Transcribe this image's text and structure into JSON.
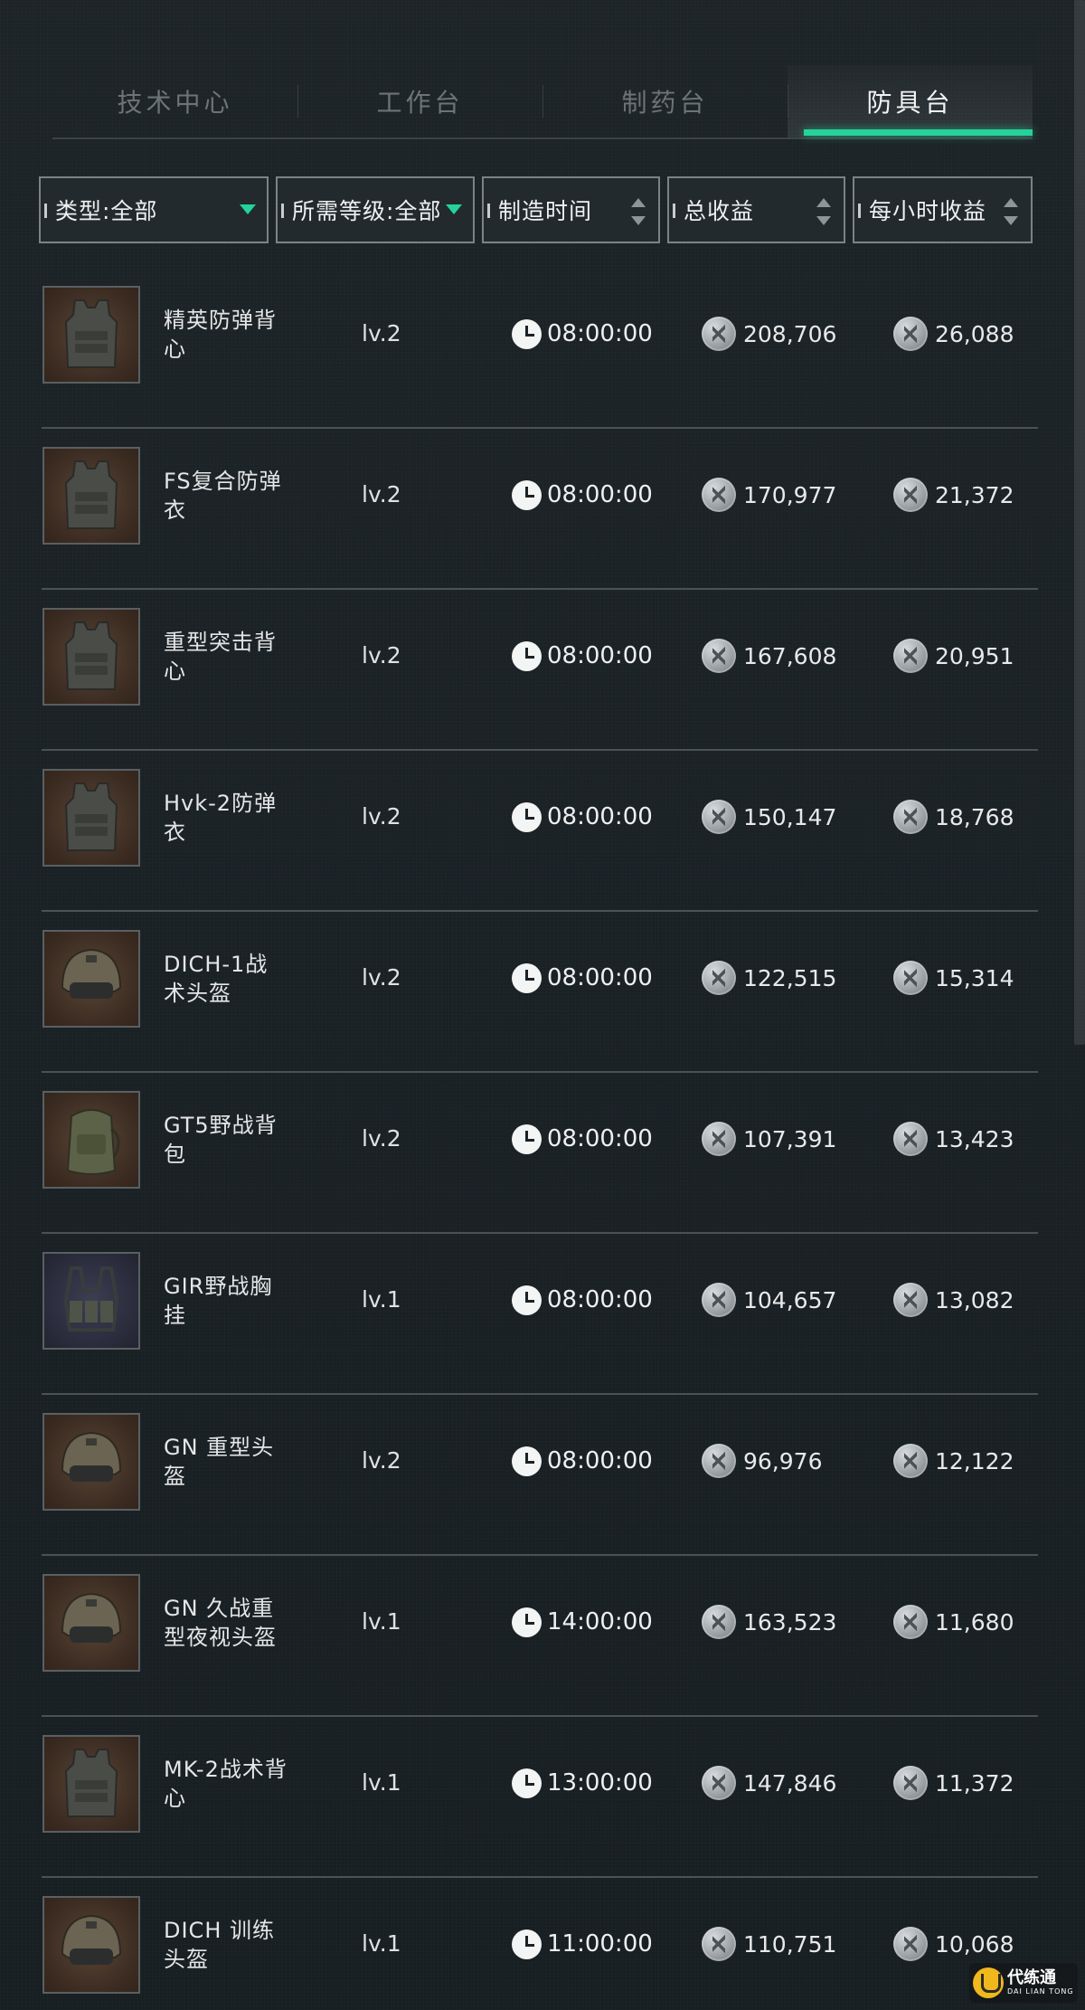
{
  "tabs": [
    {
      "label": "技术中心",
      "active": false
    },
    {
      "label": "工作台",
      "active": false
    },
    {
      "label": "制药台",
      "active": false
    },
    {
      "label": "防具台",
      "active": true
    }
  ],
  "filters": {
    "type": "类型:全部",
    "level": "所需等级:全部",
    "time": "制造时间",
    "total": "总收益",
    "hourly": "每小时收益"
  },
  "colors": {
    "accent": "#24d39a",
    "background": "#1b2226"
  },
  "items": [
    {
      "name": "精英防弹背心",
      "level": "lv.2",
      "time": "08:00:00",
      "total": "208,706",
      "hourly": "26,088",
      "icon": "vest-icon"
    },
    {
      "name": "FS复合防弹衣",
      "level": "lv.2",
      "time": "08:00:00",
      "total": "170,977",
      "hourly": "21,372",
      "icon": "vest-icon"
    },
    {
      "name": "重型突击背心",
      "level": "lv.2",
      "time": "08:00:00",
      "total": "167,608",
      "hourly": "20,951",
      "icon": "vest-icon"
    },
    {
      "name": "Hvk-2防弹衣",
      "level": "lv.2",
      "time": "08:00:00",
      "total": "150,147",
      "hourly": "18,768",
      "icon": "vest-icon"
    },
    {
      "name": "DICH-1战术头盔",
      "level": "lv.2",
      "time": "08:00:00",
      "total": "122,515",
      "hourly": "15,314",
      "icon": "helmet-icon"
    },
    {
      "name": "GT5野战背包",
      "level": "lv.2",
      "time": "08:00:00",
      "total": "107,391",
      "hourly": "13,423",
      "icon": "backpack-icon"
    },
    {
      "name": "GIR野战胸挂",
      "level": "lv.1",
      "time": "08:00:00",
      "total": "104,657",
      "hourly": "13,082",
      "icon": "chest-rig-icon"
    },
    {
      "name": "GN 重型头盔",
      "level": "lv.2",
      "time": "08:00:00",
      "total": "96,976",
      "hourly": "12,122",
      "icon": "helmet-icon"
    },
    {
      "name": "GN 久战重型夜视头盔",
      "level": "lv.1",
      "time": "14:00:00",
      "total": "163,523",
      "hourly": "11,680",
      "icon": "helmet-icon"
    },
    {
      "name": "MK-2战术背心",
      "level": "lv.1",
      "time": "13:00:00",
      "total": "147,846",
      "hourly": "11,372",
      "icon": "vest-icon"
    },
    {
      "name": "DICH 训练头盔",
      "level": "lv.1",
      "time": "11:00:00",
      "total": "110,751",
      "hourly": "10,068",
      "icon": "helmet-icon"
    }
  ],
  "watermark": {
    "main": "代练通",
    "sub": "DAI LIAN TONG"
  }
}
